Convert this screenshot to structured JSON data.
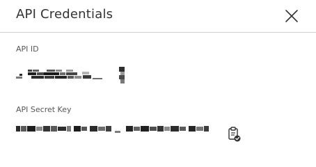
{
  "dialog": {
    "title": "API Credentials",
    "close_icon": "close-icon"
  },
  "fields": {
    "api_id": {
      "label": "API ID",
      "value_redacted": true
    },
    "api_secret": {
      "label": "API Secret Key",
      "value_redacted": true,
      "copy_icon": "clipboard-check-icon"
    }
  },
  "colors": {
    "text": "#333333",
    "label": "#565656",
    "divider": "#cfcfcf",
    "icon": "#333333"
  }
}
